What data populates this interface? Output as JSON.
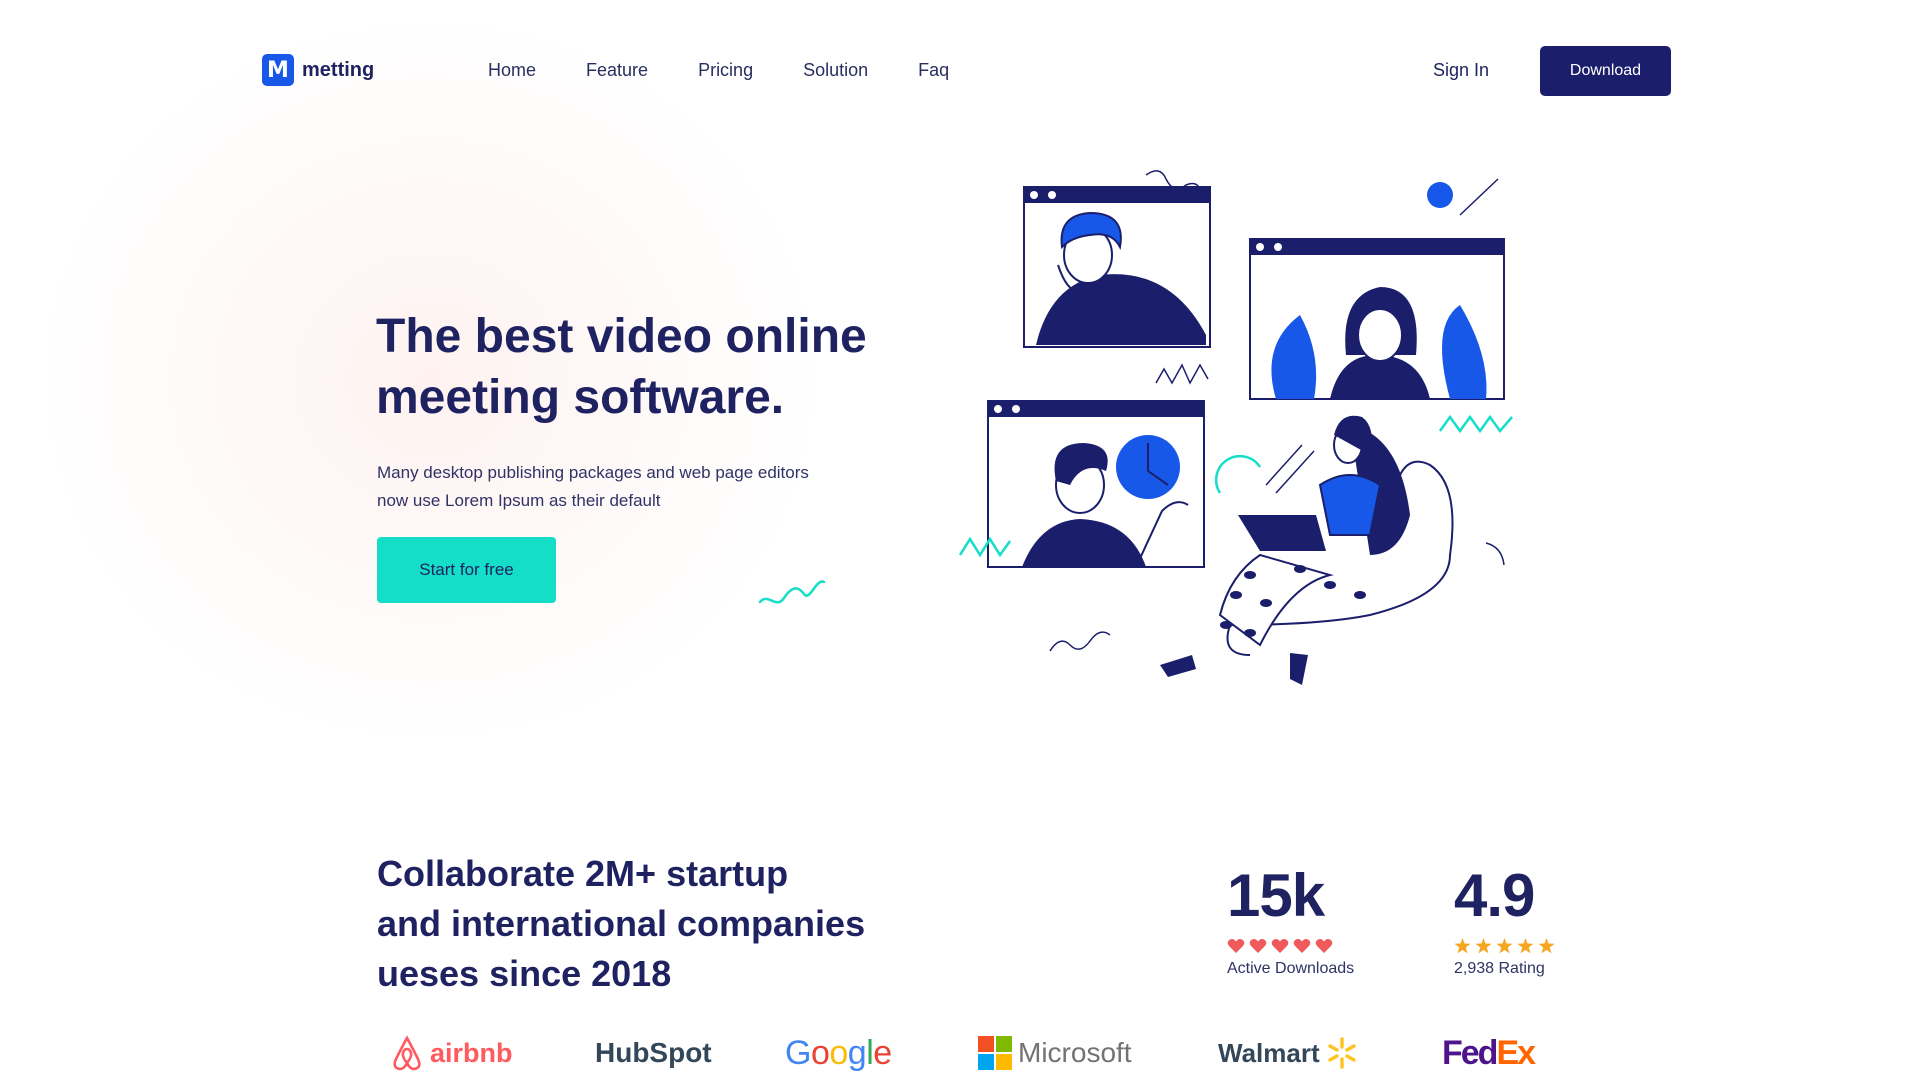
{
  "brand": {
    "name": "metting",
    "logo_letter": "M"
  },
  "nav": {
    "items": [
      {
        "label": "Home"
      },
      {
        "label": "Feature"
      },
      {
        "label": "Pricing"
      },
      {
        "label": "Solution"
      },
      {
        "label": "Faq"
      }
    ],
    "signin_label": "Sign In",
    "download_label": "Download"
  },
  "hero": {
    "title_line1": "The best video online",
    "title_line2": "meeting software.",
    "subtitle_line1": "Many desktop publishing packages and web page editors",
    "subtitle_line2": "now use Lorem Ipsum as their default",
    "cta_label": "Start for free"
  },
  "collab": {
    "line1": "Collaborate 2M+ startup",
    "line2": "and international companies",
    "line3": "ueses since 2018"
  },
  "stats": {
    "downloads": {
      "value": "15k",
      "label": "Active Downloads",
      "hearts": 5
    },
    "rating": {
      "value": "4.9",
      "label": "2,938 Rating",
      "stars": 5
    }
  },
  "logos": {
    "airbnb": "airbnb",
    "hubspot": "HubSpot",
    "google": "Google",
    "microsoft": "Microsoft",
    "walmart": "Walmart",
    "fedex_fed": "Fed",
    "fedex_ex": "Ex"
  },
  "colors": {
    "navy": "#1b1f6b",
    "accent_blue": "#1858e8",
    "teal": "#14dec8",
    "heart": "#f05a5a",
    "star": "#f5a623"
  }
}
